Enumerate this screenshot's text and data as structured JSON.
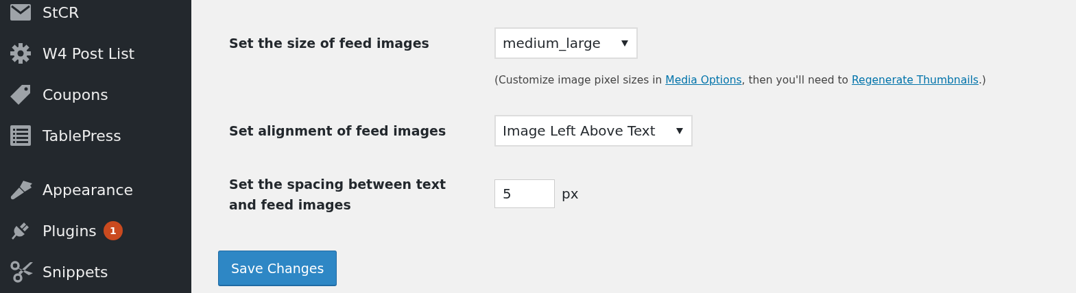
{
  "sidebar": {
    "groups": [
      [
        {
          "label": "StCR"
        },
        {
          "label": "W4 Post List"
        },
        {
          "label": "Coupons"
        },
        {
          "label": "TablePress"
        }
      ],
      [
        {
          "label": "Appearance"
        },
        {
          "label": "Plugins",
          "badge": "1"
        },
        {
          "label": "Snippets"
        }
      ]
    ]
  },
  "settings": [
    {
      "kind": "select",
      "label": "Set the size of feed images",
      "value": "medium_large",
      "help": [
        {
          "kind": "text",
          "text": "(Customize image pixel sizes in "
        },
        {
          "kind": "link",
          "text": "Media Options"
        },
        {
          "kind": "text",
          "text": ", then you'll need to "
        },
        {
          "kind": "link",
          "text": "Regenerate Thumbnails"
        },
        {
          "kind": "text",
          "text": ".)"
        }
      ]
    },
    {
      "kind": "select",
      "label": "Set alignment of feed images",
      "value": "Image Left Above Text"
    },
    {
      "kind": "number",
      "label": "Set the spacing between text and feed images",
      "value": "5",
      "unit": "px"
    }
  ],
  "save_button": "Save Changes"
}
